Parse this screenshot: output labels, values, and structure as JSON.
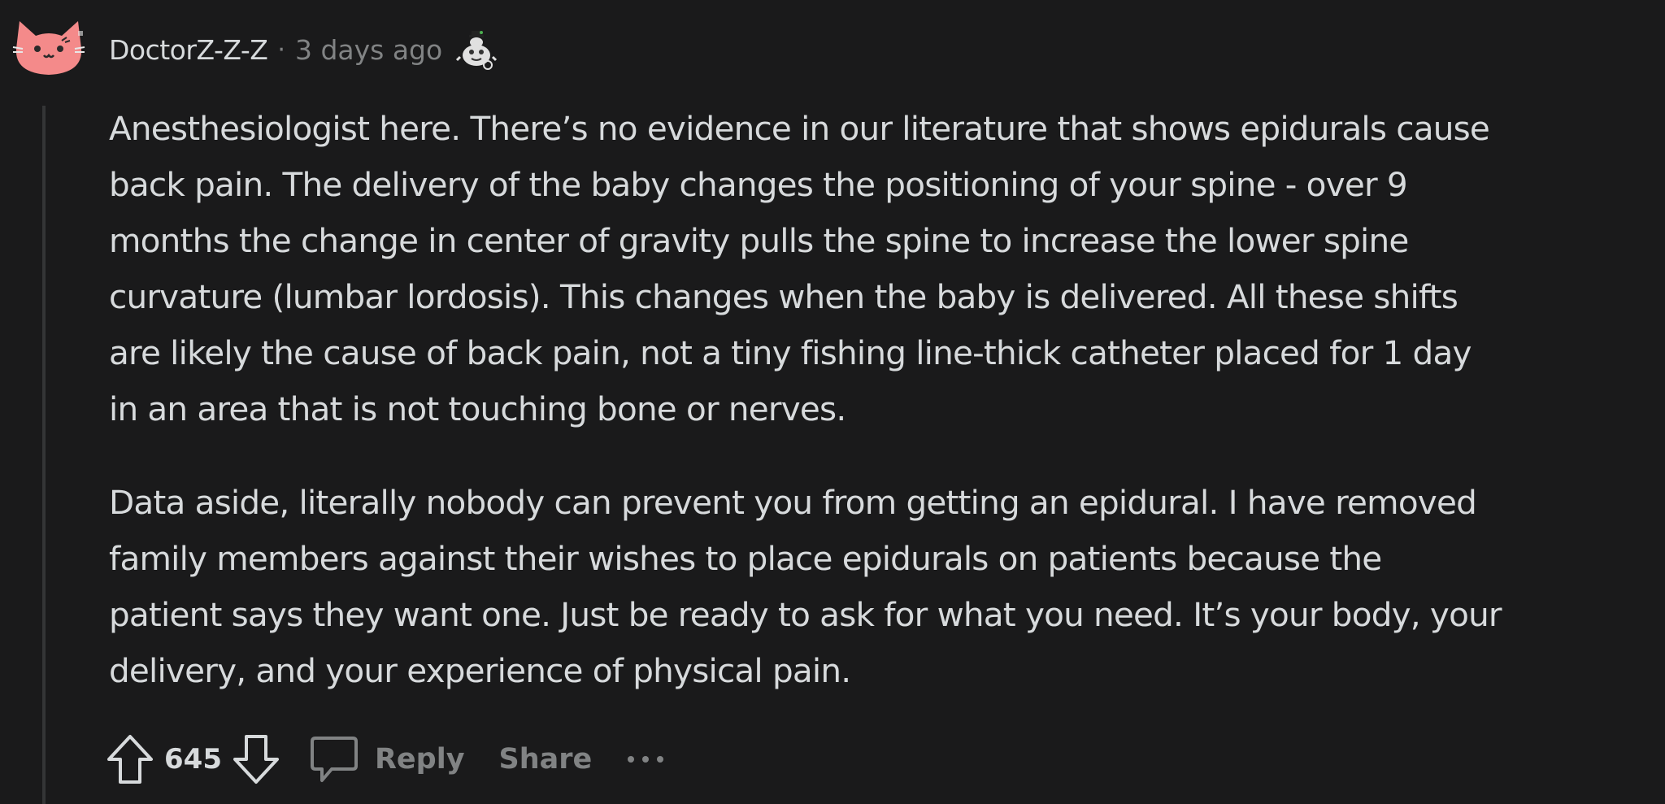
{
  "comment": {
    "author": "DoctorZ-Z-Z",
    "separator": "·",
    "timestamp": "3 days ago",
    "avatar_icon": "cat-avatar-icon",
    "flair_icon": "award-icon",
    "avatar_color": "#f48a8a",
    "paragraphs": [
      "Anesthesiologist here. There’s no evidence in our literature that shows epidurals cause\nback pain. The delivery of the baby changes the positioning of your spine - over 9\nmonths the change in center of gravity pulls the spine to increase the lower spine\ncurvature (lumbar lordosis). This changes when the baby is delivered. All these shifts\nare likely the cause of back pain, not a tiny fishing line-thick catheter placed for 1 day\nin an area that is not touching bone or nerves.",
      "Data aside, literally nobody can prevent you from getting an epidural. I have removed\nfamily members against their wishes to place epidurals on patients because the\npatient says they want one. Just be ready to ask for what you need. It’s your body, your\ndelivery, and your experience of physical pain."
    ]
  },
  "actions": {
    "score": "645",
    "upvote_icon": "upvote-arrow-icon",
    "downvote_icon": "downvote-arrow-icon",
    "reply_icon": "speech-bubble-icon",
    "reply_label": "Reply",
    "share_label": "Share",
    "more_icon": "ellipsis-icon"
  },
  "colors": {
    "background": "#1a1a1b",
    "text": "#d7dadc",
    "muted": "#818384",
    "thread_line": "#343536"
  }
}
